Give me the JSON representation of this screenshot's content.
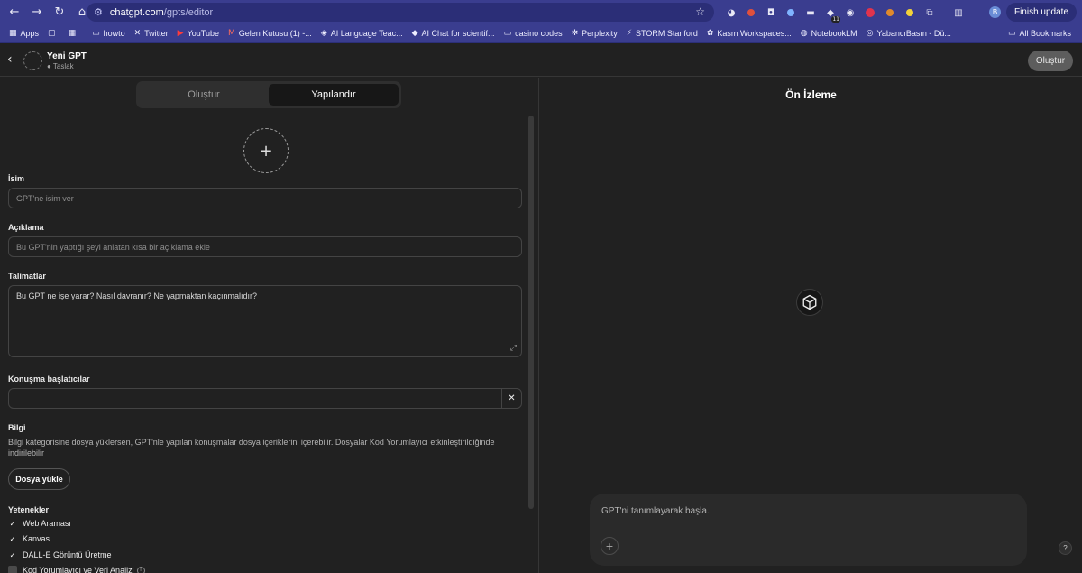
{
  "browser": {
    "url_host": "chatgpt.com",
    "url_path": "/gpts/editor",
    "finish_update": "Finish update",
    "profile_letter": "B",
    "ext_badge": "11",
    "bookmarks": [
      {
        "label": "Apps",
        "icon": "apps-grid-icon"
      },
      {
        "label": "",
        "icon": "doc-icon"
      },
      {
        "label": "",
        "icon": "grid-icon"
      },
      {
        "label": "howto",
        "icon": "folder-icon"
      },
      {
        "label": "Twitter",
        "icon": "x-icon"
      },
      {
        "label": "YouTube",
        "icon": "youtube-icon"
      },
      {
        "label": "Gelen Kutusu (1) -...",
        "icon": "gmail-icon"
      },
      {
        "label": "AI Language Teac...",
        "icon": "ai-icon"
      },
      {
        "label": "AI Chat for scientif...",
        "icon": "ai-chat-icon"
      },
      {
        "label": "casino codes",
        "icon": "folder-icon"
      },
      {
        "label": "Perplexity",
        "icon": "perplexity-icon"
      },
      {
        "label": "STORM Stanford",
        "icon": "storm-icon"
      },
      {
        "label": "Kasm Workspaces...",
        "icon": "kasm-icon"
      },
      {
        "label": "NotebookLM",
        "icon": "notebooklm-icon"
      },
      {
        "label": "YabancıBasın - Dü...",
        "icon": "globe-icon"
      }
    ],
    "all_bookmarks": "All Bookmarks"
  },
  "header": {
    "name": "Yeni GPT",
    "status": "● Taslak",
    "publish_label": "Oluştur"
  },
  "editor": {
    "tabs": [
      {
        "label": "Oluştur",
        "active": false
      },
      {
        "label": "Yapılandır",
        "active": true
      }
    ],
    "name_label": "İsim",
    "name_placeholder": "GPT'ne isim ver",
    "description_label": "Açıklama",
    "description_placeholder": "Bu GPT'nin yaptığı şeyi anlatan kısa bir açıklama ekle",
    "instructions_label": "Talimatlar",
    "instructions_placeholder": "Bu GPT ne işe yarar? Nasıl davranır? Ne yapmaktan kaçınmalıdır?",
    "starters_label": "Konuşma başlatıcılar",
    "knowledge_label": "Bilgi",
    "knowledge_desc": "Bilgi kategorisine dosya yüklersen, GPT'nle yapılan konuşmalar dosya içeriklerini içerebilir. Dosyalar Kod Yorumlayıcı etkinleştirildiğinde indirilebilir",
    "upload_label": "Dosya yükle",
    "capabilities_label": "Yetenekler",
    "capabilities": [
      {
        "label": "Web Araması",
        "checked": true
      },
      {
        "label": "Kanvas",
        "checked": true
      },
      {
        "label": "DALL-E Görüntü Üretme",
        "checked": true
      },
      {
        "label": "Kod Yorumlayıcı ve Veri Analizi",
        "checked": false
      }
    ]
  },
  "preview": {
    "title": "Ön İzleme",
    "composer_placeholder": "GPT'ni tanımlayarak başla.",
    "help": "?"
  }
}
